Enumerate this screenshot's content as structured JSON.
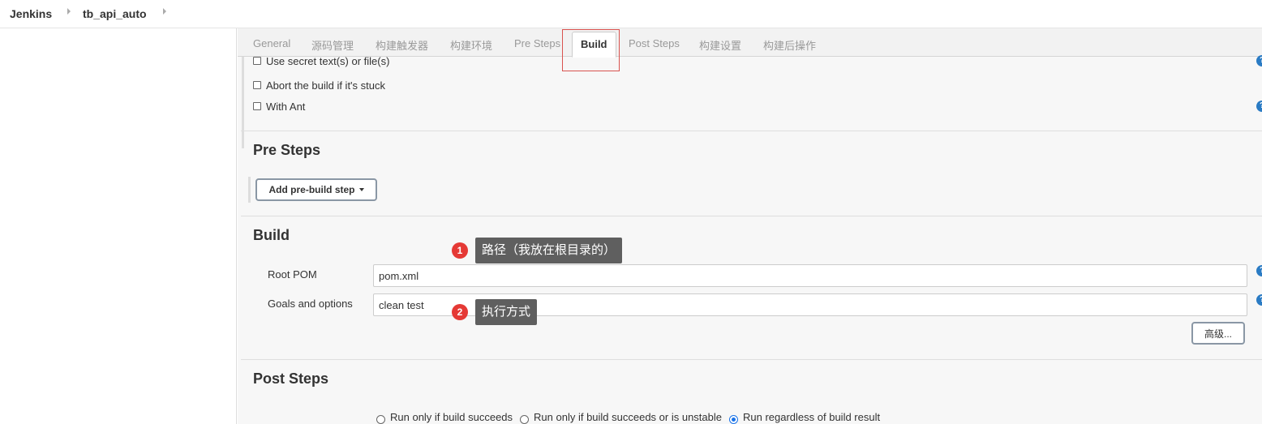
{
  "breadcrumb": {
    "items": [
      "Jenkins",
      "tb_api_auto"
    ]
  },
  "tabs": [
    {
      "label": "General",
      "active": false
    },
    {
      "label": "源码管理",
      "active": false
    },
    {
      "label": "构建触发器",
      "active": false
    },
    {
      "label": "构建环境",
      "active": false
    },
    {
      "label": "Pre Steps",
      "active": false
    },
    {
      "label": "Build",
      "active": true
    },
    {
      "label": "Post Steps",
      "active": false
    },
    {
      "label": "构建设置",
      "active": false
    },
    {
      "label": "构建后操作",
      "active": false
    }
  ],
  "build_env": {
    "options": [
      {
        "label": "Use secret text(s) or file(s)",
        "checked": false
      },
      {
        "label": "Abort the build if it's stuck",
        "checked": false
      },
      {
        "label": "With Ant",
        "checked": false
      }
    ]
  },
  "pre_steps": {
    "title": "Pre Steps",
    "add_button": "Add pre-build step"
  },
  "build": {
    "title": "Build",
    "root_pom_label": "Root POM",
    "root_pom_value": "pom.xml",
    "goals_label": "Goals and options",
    "goals_value": "clean test",
    "advanced_button": "高级..."
  },
  "post_steps": {
    "title": "Post Steps",
    "options": [
      {
        "label": "Run only if build succeeds",
        "selected": false
      },
      {
        "label": "Run only if build succeeds or is unstable",
        "selected": false
      },
      {
        "label": "Run regardless of build result",
        "selected": true
      }
    ]
  },
  "annotations": [
    {
      "number": "1",
      "text": "路径（我放在根目录的）"
    },
    {
      "number": "2",
      "text": "执行方式"
    }
  ],
  "icons": {
    "help": "help-icon",
    "breadcrumb_separator": "chevron-right-icon",
    "dropdown": "caret-down-icon"
  },
  "colors": {
    "help_icon": "#2a7bc4",
    "annotation_badge": "#e53935",
    "annotation_box": "#5f5f5f",
    "tab_highlight": "#d9534f",
    "radio_selected": "#1a73e8"
  }
}
